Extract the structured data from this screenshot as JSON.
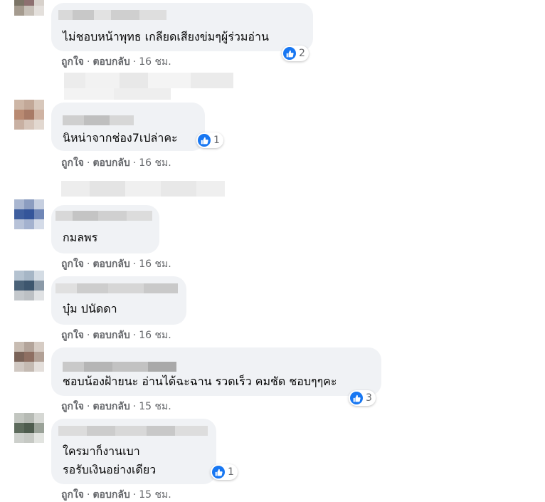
{
  "icons": {
    "like": "thumbs-up-icon"
  },
  "colors": {
    "bubble": "#f0f2f5",
    "like": "#1877f2",
    "meta": "#65676b"
  },
  "comments": [
    {
      "text_lines": [
        "ไม่ชอบหน้าพุทธ เกลียดเสียงข่มๆผู้ร่วมอ่าน"
      ],
      "reaction_count": "2",
      "like_label": "ถูกใจ",
      "reply_label": "ตอบกลับ",
      "separator": "·",
      "time": "16 ชม."
    },
    {
      "text_lines": [
        "นิหน่าจากช่อง7เปล่าคะ"
      ],
      "reaction_count": "1",
      "like_label": "ถูกใจ",
      "reply_label": "ตอบกลับ",
      "separator": "·",
      "time": "16 ชม."
    },
    {
      "text_lines": [
        "กมลพร"
      ],
      "reaction_count": "",
      "like_label": "ถูกใจ",
      "reply_label": "ตอบกลับ",
      "separator": "·",
      "time": "16 ชม."
    },
    {
      "text_lines": [
        "บุ๋ม ปนัดดา"
      ],
      "reaction_count": "",
      "like_label": "ถูกใจ",
      "reply_label": "ตอบกลับ",
      "separator": "·",
      "time": "16 ชม."
    },
    {
      "text_lines": [
        "ชอบน้องฝ้ายนะ อ่านได้ฉะฉาน รวดเร็ว คมชัด ชอบๆๆคะ"
      ],
      "reaction_count": "3",
      "like_label": "ถูกใจ",
      "reply_label": "ตอบกลับ",
      "separator": "·",
      "time": "15 ชม."
    },
    {
      "text_lines": [
        "ใครมาก็งานเบา",
        "รอรับเงินอย่างเดียว"
      ],
      "reaction_count": "1",
      "like_label": "ถูกใจ",
      "reply_label": "ตอบกลับ",
      "separator": "·",
      "time": "15 ชม."
    }
  ]
}
